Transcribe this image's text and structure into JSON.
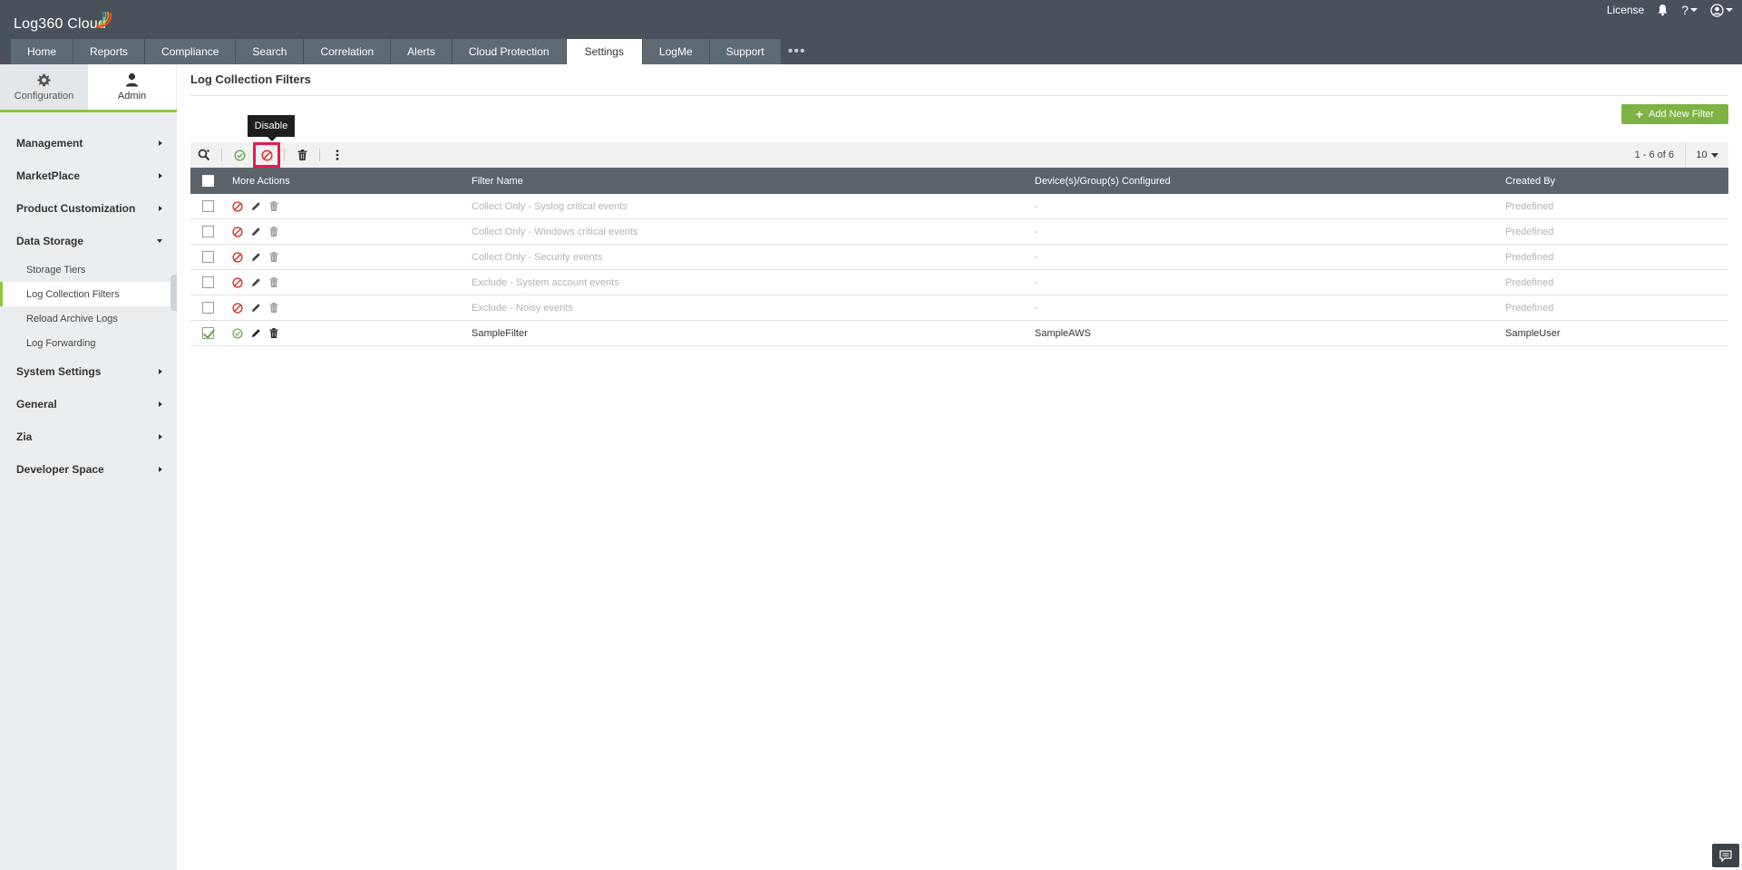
{
  "app": {
    "name": "Log360",
    "suffix": "Cloud",
    "license_link": "License"
  },
  "nav": {
    "tabs": [
      {
        "label": "Home"
      },
      {
        "label": "Reports"
      },
      {
        "label": "Compliance"
      },
      {
        "label": "Search"
      },
      {
        "label": "Correlation"
      },
      {
        "label": "Alerts"
      },
      {
        "label": "Cloud Protection"
      },
      {
        "label": "Settings",
        "active": true
      },
      {
        "label": "LogMe"
      },
      {
        "label": "Support"
      }
    ],
    "more": "•••"
  },
  "sidebar": {
    "tabs": [
      {
        "label": "Configuration",
        "icon": "gear-icon"
      },
      {
        "label": "Admin",
        "icon": "user-icon",
        "active": true
      }
    ],
    "groups": [
      {
        "label": "Management"
      },
      {
        "label": "MarketPlace"
      },
      {
        "label": "Product Customization"
      },
      {
        "label": "Data Storage",
        "expanded": true,
        "items": [
          "Storage Tiers",
          "Log Collection Filters",
          "Reload Archive Logs",
          "Log Forwarding"
        ]
      },
      {
        "label": "System Settings"
      },
      {
        "label": "General"
      },
      {
        "label": "Zia"
      },
      {
        "label": "Developer Space"
      }
    ],
    "active_item": "Log Collection Filters"
  },
  "main": {
    "title": "Log Collection Filters",
    "add_button": "Add New Filter",
    "tooltip": "Disable",
    "pager": "1 - 6 of 6",
    "per_page": "10",
    "columns": [
      "More Actions",
      "Filter Name",
      "Device(s)/Group(s) Configured",
      "Created By"
    ],
    "rows": [
      {
        "name": "Collect Only - Syslog critical events",
        "devices": "-",
        "created_by": "Predefined",
        "status": "disabled",
        "checked": false
      },
      {
        "name": "Collect Only - Windows critical events",
        "devices": "-",
        "created_by": "Predefined",
        "status": "disabled",
        "checked": false
      },
      {
        "name": "Collect Only - Security events",
        "devices": "-",
        "created_by": "Predefined",
        "status": "disabled",
        "checked": false
      },
      {
        "name": "Exclude - System account events",
        "devices": "-",
        "created_by": "Predefined",
        "status": "disabled",
        "checked": false
      },
      {
        "name": "Exclude - Noisy events",
        "devices": "-",
        "created_by": "Predefined",
        "status": "disabled",
        "checked": false
      },
      {
        "name": "SampleFilter",
        "devices": "SampleAWS",
        "created_by": "SampleUser",
        "status": "enabled",
        "checked": true
      }
    ]
  },
  "colors": {
    "header_bg": "#49525a",
    "accent_green": "#8dc63f",
    "add_button": "#7cb342",
    "disable_red": "#d9312b",
    "enable_green": "#6aa84f",
    "highlight_pink": "#e8194f"
  }
}
